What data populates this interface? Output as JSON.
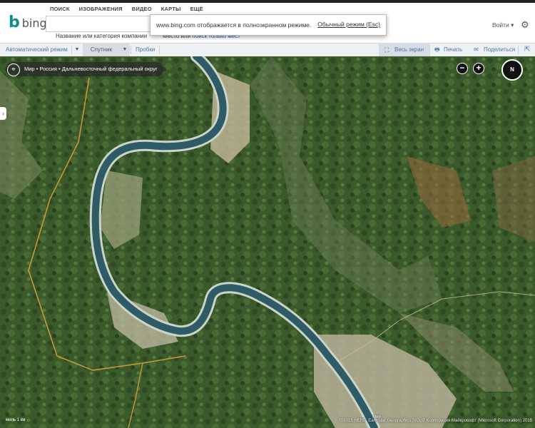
{
  "top_nav": [
    "ПОИСК",
    "ИЗОБРАЖЕНИЯ",
    "ВИДЕО",
    "КАРТЫ",
    "ЕЩЁ"
  ],
  "brand": {
    "mark": "b",
    "word": "bing"
  },
  "search": {
    "hint_business": "Название или категория компании",
    "hint_place": "Место или",
    "hint_place_link": "поиск только мест"
  },
  "fullscreen_notice": {
    "message": "www.bing.com отображается в полноэкранном режиме.",
    "exit_link": "Обычный режим (Esc)"
  },
  "account": {
    "signin": "Войти ▾"
  },
  "toolbar": {
    "auto_mode": "Автоматический режим",
    "satellite": "Спутник",
    "traffic": "Пробки",
    "fullscreen": "Весь экран",
    "print": "Печать",
    "share": "Поделиться"
  },
  "map": {
    "breadcrumb": "Мир • Россия • Дальневосточный федеральный округ",
    "zoom_out": "−",
    "zoom_in": "+",
    "compass": "N",
    "scale_label": "миль 1   км",
    "town_label": "Мир",
    "copyright": "© 2015 HERE, Earthstar Geographics SIO, © Корпорация Майкрософт (Microsoft Corporation) 2015"
  },
  "colors": {
    "brand": "#0a8f8f",
    "link": "#1a5fb4",
    "toolbar_bg": "#eef1f4",
    "forest": "#3d5a2a",
    "river": "#2f5b66"
  }
}
